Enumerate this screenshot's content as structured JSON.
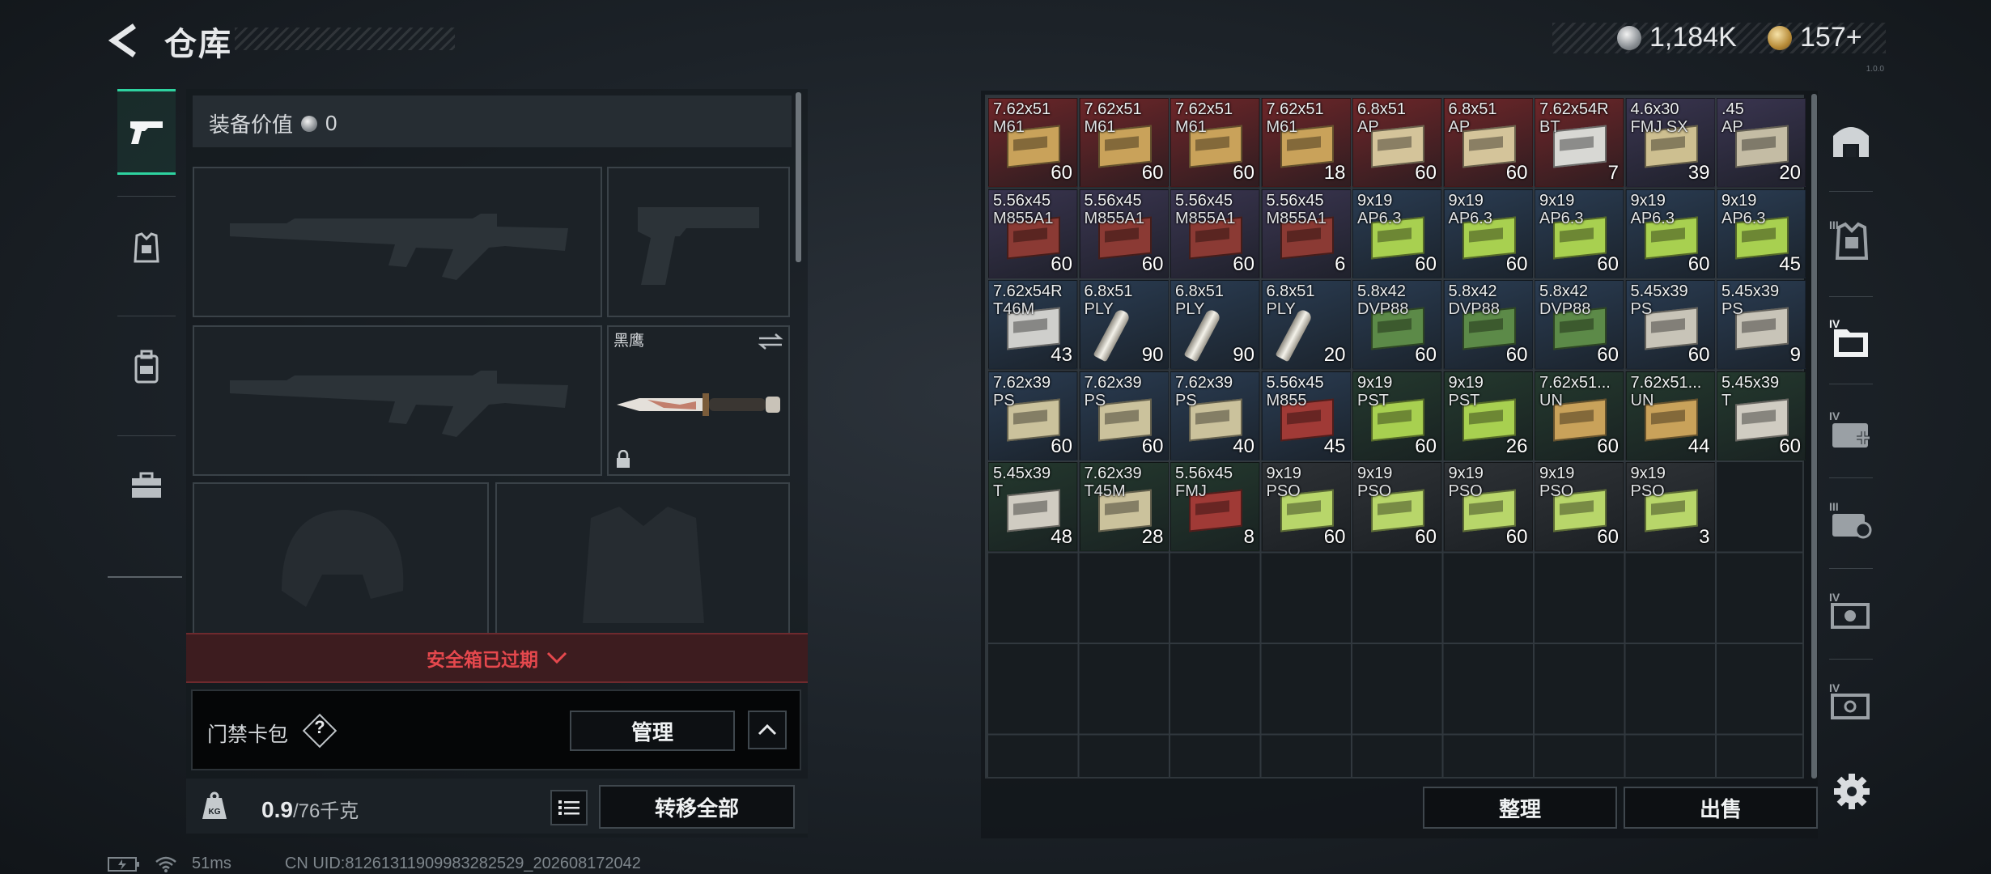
{
  "header": {
    "title": "仓库",
    "currency": "1,184K",
    "premium": "157+",
    "version": "1.0.0"
  },
  "tabs": [
    {
      "name": "weapons",
      "icon": "pistol-icon",
      "selected": true
    },
    {
      "name": "armor",
      "icon": "armor-vest-icon",
      "selected": false
    },
    {
      "name": "backpack",
      "icon": "backpack-icon",
      "selected": false
    },
    {
      "name": "toolbox",
      "icon": "toolbox-icon",
      "selected": false
    }
  ],
  "loadout": {
    "value_label": "装备价值",
    "value": "0",
    "melee_name": "黑鹰",
    "safe_box_expired": "安全箱已过期",
    "keycard_label": "门禁卡包",
    "keycard_help": "?",
    "manage_label": "管理",
    "weight_current": "0.9",
    "weight_max": "/76千克",
    "transfer_all": "转移全部"
  },
  "status": {
    "ping": "51ms",
    "uid": "CN UID:8126131190998328​2529_202608172042"
  },
  "stash": {
    "sort_label": "整理",
    "sell_label": "出售",
    "items": [
      {
        "cal": "7.62x51",
        "sub": "M61",
        "count": "60",
        "bg": "#6e2629",
        "box": "#c9a25a",
        "kind": "box"
      },
      {
        "cal": "7.62x51",
        "sub": "M61",
        "count": "60",
        "bg": "#6e2629",
        "box": "#c9a25a",
        "kind": "box"
      },
      {
        "cal": "7.62x51",
        "sub": "M61",
        "count": "60",
        "bg": "#6e2629",
        "box": "#c9a25a",
        "kind": "box"
      },
      {
        "cal": "7.62x51",
        "sub": "M61",
        "count": "18",
        "bg": "#6e2629",
        "box": "#c9a25a",
        "kind": "box"
      },
      {
        "cal": "6.8x51",
        "sub": "AP",
        "count": "60",
        "bg": "#6e2629",
        "box": "#d4c49a",
        "kind": "box"
      },
      {
        "cal": "6.8x51",
        "sub": "AP",
        "count": "60",
        "bg": "#6e2629",
        "box": "#d4c49a",
        "kind": "box"
      },
      {
        "cal": "7.62x54R",
        "sub": "BT",
        "count": "7",
        "bg": "#6e2629",
        "box": "#d8d8d4",
        "kind": "box"
      },
      {
        "cal": "4.6x30",
        "sub": "FMJ SX",
        "count": "39",
        "bg": "#3a3550",
        "box": "#cdbf90",
        "kind": "box"
      },
      {
        "cal": ".45",
        "sub": "AP",
        "count": "20",
        "bg": "#3a3550",
        "box": "#c4bca4",
        "kind": "box"
      },
      {
        "cal": "5.56x45",
        "sub": "M855A1",
        "count": "60",
        "bg": "#3a3550",
        "box": "#8b3a34",
        "kind": "box"
      },
      {
        "cal": "5.56x45",
        "sub": "M855A1",
        "count": "60",
        "bg": "#3a3550",
        "box": "#8b3a34",
        "kind": "box"
      },
      {
        "cal": "5.56x45",
        "sub": "M855A1",
        "count": "60",
        "bg": "#3a3550",
        "box": "#8b3a34",
        "kind": "box"
      },
      {
        "cal": "5.56x45",
        "sub": "M855A1",
        "count": "6",
        "bg": "#3a3550",
        "box": "#8b3a34",
        "kind": "box"
      },
      {
        "cal": "9x19",
        "sub": "AP6.3",
        "count": "60",
        "bg": "#2a3c52",
        "box": "#a8d050",
        "kind": "box"
      },
      {
        "cal": "9x19",
        "sub": "AP6.3",
        "count": "60",
        "bg": "#2a3c52",
        "box": "#a8d050",
        "kind": "box"
      },
      {
        "cal": "9x19",
        "sub": "AP6.3",
        "count": "60",
        "bg": "#2a3c52",
        "box": "#a8d050",
        "kind": "box"
      },
      {
        "cal": "9x19",
        "sub": "AP6.3",
        "count": "60",
        "bg": "#2a3c52",
        "box": "#a8d050",
        "kind": "box"
      },
      {
        "cal": "9x19",
        "sub": "AP6.3",
        "count": "45",
        "bg": "#2a3c52",
        "box": "#a8d050",
        "kind": "box"
      },
      {
        "cal": "7.62x54R",
        "sub": "T46M",
        "count": "43",
        "bg": "#2a3c52",
        "box": "#cfcfcc",
        "kind": "box"
      },
      {
        "cal": "6.8x51",
        "sub": "PLY",
        "count": "90",
        "bg": "#2a3c52",
        "box": "#e8e6e0",
        "kind": "cart"
      },
      {
        "cal": "6.8x51",
        "sub": "PLY",
        "count": "90",
        "bg": "#2a3c52",
        "box": "#e8e6e0",
        "kind": "cart"
      },
      {
        "cal": "6.8x51",
        "sub": "PLY",
        "count": "20",
        "bg": "#2a3c52",
        "box": "#e8e6e0",
        "kind": "cart"
      },
      {
        "cal": "5.8x42",
        "sub": "DVP88",
        "count": "60",
        "bg": "#2a3c52",
        "box": "#5c8a48",
        "kind": "box"
      },
      {
        "cal": "5.8x42",
        "sub": "DVP88",
        "count": "60",
        "bg": "#2a3c52",
        "box": "#5c8a48",
        "kind": "box"
      },
      {
        "cal": "5.8x42",
        "sub": "DVP88",
        "count": "60",
        "bg": "#2a3c52",
        "box": "#5c8a48",
        "kind": "box"
      },
      {
        "cal": "5.45x39",
        "sub": "PS",
        "count": "60",
        "bg": "#2a3c52",
        "box": "#c8c4b8",
        "kind": "box"
      },
      {
        "cal": "5.45x39",
        "sub": "PS",
        "count": "9",
        "bg": "#2a3c52",
        "box": "#c8c4b8",
        "kind": "box"
      },
      {
        "cal": "7.62x39",
        "sub": "PS",
        "count": "60",
        "bg": "#2a3c52",
        "box": "#cbc29c",
        "kind": "box"
      },
      {
        "cal": "7.62x39",
        "sub": "PS",
        "count": "60",
        "bg": "#2a3c52",
        "box": "#cbc29c",
        "kind": "box"
      },
      {
        "cal": "7.62x39",
        "sub": "PS",
        "count": "40",
        "bg": "#2a3c52",
        "box": "#cbc29c",
        "kind": "box"
      },
      {
        "cal": "5.56x45",
        "sub": "M855",
        "count": "45",
        "bg": "#2a3c52",
        "box": "#a03a36",
        "kind": "box"
      },
      {
        "cal": "9x19",
        "sub": "PST",
        "count": "60",
        "bg": "#24392e",
        "box": "#a8d050",
        "kind": "box"
      },
      {
        "cal": "9x19",
        "sub": "PST",
        "count": "26",
        "bg": "#24392e",
        "box": "#a8d050",
        "kind": "box"
      },
      {
        "cal": "7.62x51...",
        "sub": "UN",
        "count": "60",
        "bg": "#24392e",
        "box": "#c9a25a",
        "kind": "box"
      },
      {
        "cal": "7.62x51...",
        "sub": "UN",
        "count": "44",
        "bg": "#24392e",
        "box": "#c9a25a",
        "kind": "box"
      },
      {
        "cal": "5.45x39",
        "sub": "T",
        "count": "60",
        "bg": "#24392e",
        "box": "#d0ccc2",
        "kind": "box"
      },
      {
        "cal": "5.45x39",
        "sub": "T",
        "count": "48",
        "bg": "#24392e",
        "box": "#d0ccc2",
        "kind": "box"
      },
      {
        "cal": "7.62x39",
        "sub": "T45M",
        "count": "28",
        "bg": "#24392e",
        "box": "#cbc29c",
        "kind": "box"
      },
      {
        "cal": "5.56x45",
        "sub": "FMJ",
        "count": "8",
        "bg": "#24392e",
        "box": "#a03a36",
        "kind": "box"
      },
      {
        "cal": "9x19",
        "sub": "PSO",
        "count": "60",
        "bg": "#2e3236",
        "box": "#b8d66a",
        "kind": "box"
      },
      {
        "cal": "9x19",
        "sub": "PSO",
        "count": "60",
        "bg": "#2e3236",
        "box": "#b8d66a",
        "kind": "box"
      },
      {
        "cal": "9x19",
        "sub": "PSO",
        "count": "60",
        "bg": "#2e3236",
        "box": "#b8d66a",
        "kind": "box"
      },
      {
        "cal": "9x19",
        "sub": "PSO",
        "count": "60",
        "bg": "#2e3236",
        "box": "#b8d66a",
        "kind": "box"
      },
      {
        "cal": "9x19",
        "sub": "PSO",
        "count": "3",
        "bg": "#2e3236",
        "box": "#b8d66a",
        "kind": "box"
      }
    ]
  },
  "right_icons": [
    {
      "name": "stash-home-icon",
      "badge": ""
    },
    {
      "name": "armor-tier-icon",
      "badge": "III"
    },
    {
      "name": "folder-tier-icon",
      "badge": "IV"
    },
    {
      "name": "medkit-tier-icon",
      "badge": "IV"
    },
    {
      "name": "card-tier-icon",
      "badge": "III"
    },
    {
      "name": "money-tier-icon",
      "badge": "IV"
    },
    {
      "name": "ticket-tier-icon",
      "badge": "IV"
    },
    {
      "name": "settings-icon",
      "badge": ""
    }
  ]
}
